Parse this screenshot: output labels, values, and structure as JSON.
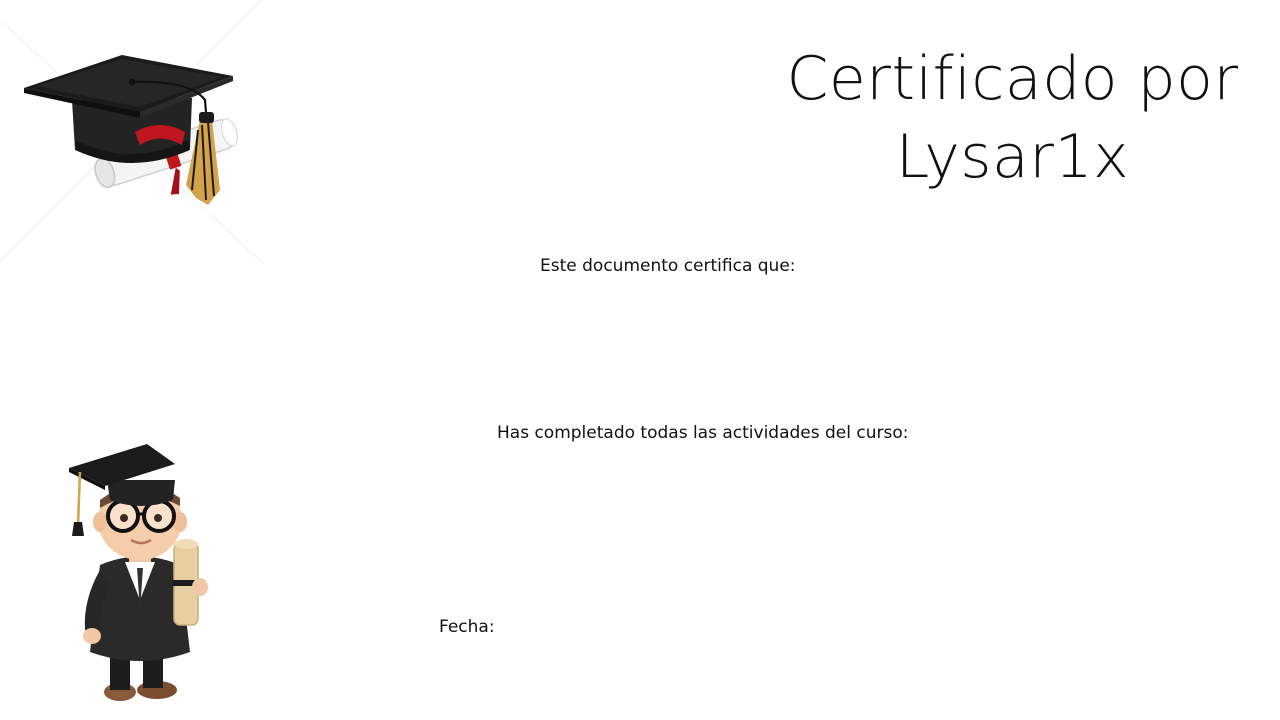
{
  "certificate": {
    "title_line1": "Certificado por",
    "title_line2": "Lysar1x",
    "certifies_label": "Este documento certifica que:",
    "completed_label": "Has completado todas las actividades del curso:",
    "date_label": "Fecha:"
  },
  "images": {
    "cap_icon": "graduation-cap-with-diploma",
    "graduate_icon": "graduate-character-holding-diploma"
  },
  "colors": {
    "text": "#111111",
    "background": "#ffffff",
    "cap": "#1b1b1b",
    "ribbon": "#c0171f",
    "tassel": "#d4a24a"
  }
}
